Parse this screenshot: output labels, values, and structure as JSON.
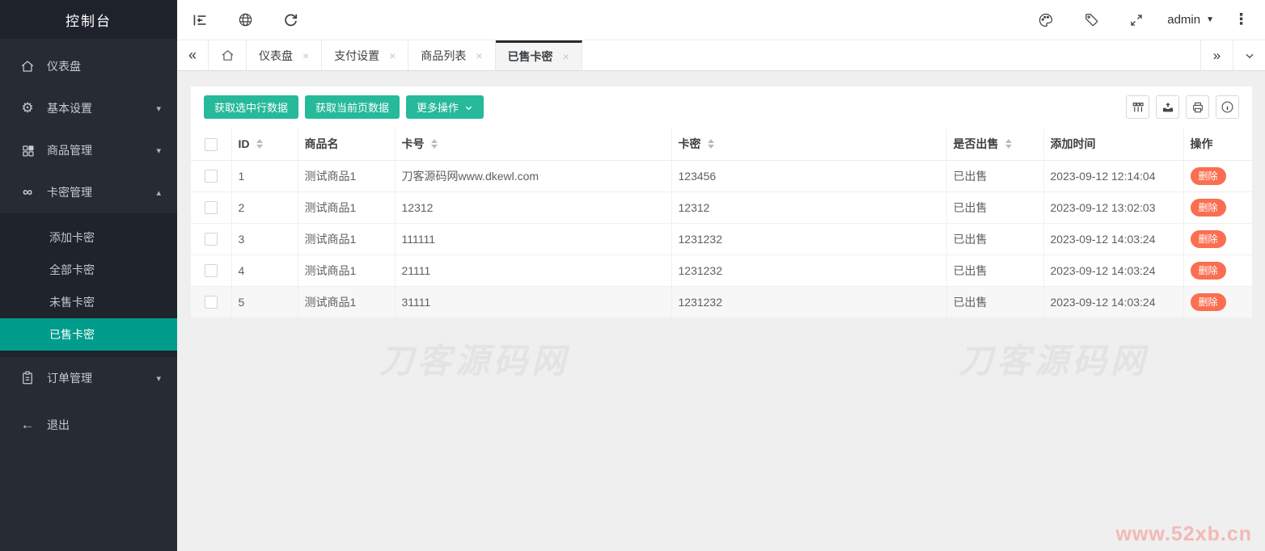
{
  "sidebar": {
    "title": "控制台",
    "items": [
      {
        "label": "仪表盘",
        "icon": "home-icon"
      },
      {
        "label": "基本设置",
        "icon": "gear-icon",
        "caret": "▾"
      },
      {
        "label": "商品管理",
        "icon": "grid-icon",
        "caret": "▾"
      },
      {
        "label": "卡密管理",
        "icon": "infinity-icon",
        "caret": "▴",
        "children": [
          "添加卡密",
          "全部卡密",
          "未售卡密",
          "已售卡密"
        ],
        "active_child": "已售卡密"
      },
      {
        "label": "订单管理",
        "icon": "clipboard-icon",
        "caret": "▾"
      },
      {
        "label": "退出",
        "icon": "back-arrow-icon"
      }
    ]
  },
  "topbar": {
    "user": "admin"
  },
  "tabs": {
    "items": [
      {
        "label": "仪表盘"
      },
      {
        "label": "支付设置"
      },
      {
        "label": "商品列表"
      },
      {
        "label": "已售卡密",
        "active": true
      }
    ]
  },
  "toolbar": {
    "get_selected_label": "获取选中行数据",
    "get_page_label": "获取当前页数据",
    "more_label": "更多操作"
  },
  "table": {
    "columns": {
      "id": "ID",
      "product": "商品名",
      "card_no": "卡号",
      "card_secret": "卡密",
      "sold": "是否出售",
      "time": "添加时间",
      "action": "操作"
    },
    "rows": [
      {
        "id": "1",
        "product": "测试商品1",
        "card_no": "刀客源码网www.dkewl.com",
        "card_secret": "123456",
        "sold": "已出售",
        "time": "2023-09-12 12:14:04",
        "action": "删除"
      },
      {
        "id": "2",
        "product": "测试商品1",
        "card_no": "12312",
        "card_secret": "12312",
        "sold": "已出售",
        "time": "2023-09-12 13:02:03",
        "action": "删除"
      },
      {
        "id": "3",
        "product": "测试商品1",
        "card_no": "111111",
        "card_secret": "1231232",
        "sold": "已出售",
        "time": "2023-09-12 14:03:24",
        "action": "删除"
      },
      {
        "id": "4",
        "product": "测试商品1",
        "card_no": "21111",
        "card_secret": "1231232",
        "sold": "已出售",
        "time": "2023-09-12 14:03:24",
        "action": "删除"
      },
      {
        "id": "5",
        "product": "测试商品1",
        "card_no": "31111",
        "card_secret": "1231232",
        "sold": "已出售",
        "time": "2023-09-12 14:03:24",
        "action": "删除"
      }
    ]
  },
  "watermarks": {
    "left": "刀客源码网",
    "right": "刀客源码网",
    "corner": "www.52xb.cn"
  },
  "icons": {
    "close": "×",
    "chevrons_left": "«",
    "chevrons_right": "»",
    "chevron_down": "∨",
    "more_chevron": "∨",
    "kebab": "⋮",
    "infinity": "∞",
    "back_arrow": "←",
    "gear": "⚙",
    "caret_down": "▾",
    "caret_up": "▴",
    "user_caret": "▼"
  },
  "colors": {
    "accent_teal_button": "#26b99a",
    "accent_teal_active": "#009c8c",
    "danger_delete": "#fa6e51",
    "sidebar_bg": "#272c34",
    "sidebar_header_bg": "#1e222a",
    "content_bg": "#efefef",
    "watermark_gray": "#e3e3e3",
    "watermark_pink": "#f2b9b6"
  }
}
